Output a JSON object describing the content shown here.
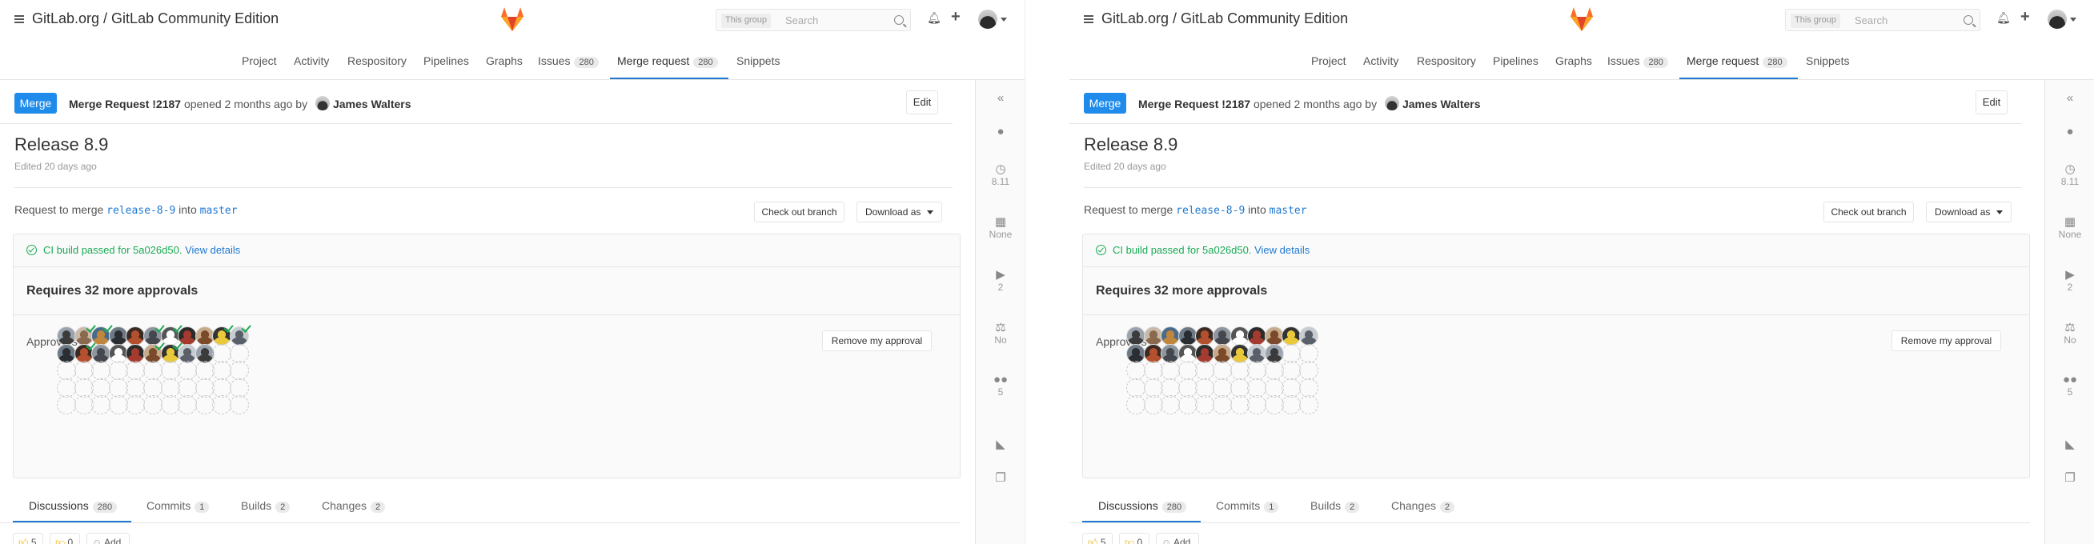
{
  "header": {
    "title": "GitLab.org / GitLab Community Edition",
    "search_scope": "This group",
    "search_placeholder": "Search"
  },
  "nav": [
    {
      "label": "Project"
    },
    {
      "label": "Activity"
    },
    {
      "label": "Respository"
    },
    {
      "label": "Pipelines"
    },
    {
      "label": "Graphs"
    },
    {
      "label": "Issues",
      "count": "280"
    },
    {
      "label": "Merge request",
      "count": "280",
      "active": true
    },
    {
      "label": "Snippets"
    }
  ],
  "mr": {
    "badge": "Merge",
    "title_strong": "Merge Request !2187",
    "opened": " opened 2 months ago by ",
    "author": "James Walters",
    "edit_label": "Edit",
    "release_title": "Release 8.9",
    "edited": "Edited 20 days ago",
    "request_prefix": "Request to merge ",
    "source_branch": "release-8-9",
    "into": " into ",
    "target_branch": "master",
    "checkout_label": "Check out branch",
    "download_label": "Download as"
  },
  "widget": {
    "ci_text": "CI build passed for 5a026d50.",
    "ci_link": "View details",
    "requires": "Requires 32 more approvals",
    "approvers_label": "Approvers",
    "remove_label": "Remove my approval"
  },
  "tabs": [
    {
      "label": "Discussions",
      "count": "280",
      "active": true
    },
    {
      "label": "Commits",
      "count": "1"
    },
    {
      "label": "Builds",
      "count": "2"
    },
    {
      "label": "Changes",
      "count": "2"
    }
  ],
  "awards": [
    {
      "icon": "thumbs-up-icon",
      "count": "5"
    },
    {
      "icon": "thumbs-down-icon",
      "count": "0"
    },
    {
      "icon": "smiley-icon",
      "label": "Add"
    }
  ],
  "sidebar": {
    "milestone": "8.11",
    "due_date": "None",
    "labels": "2",
    "lock": "No",
    "participants": "5"
  },
  "colors": {
    "accent": "#1f78d1",
    "merge_badge": "#1f8ceb",
    "success": "#1aaa55"
  },
  "screens": [
    {
      "approvers_row1": [
        1,
        1,
        1,
        1,
        1,
        1,
        1,
        1,
        1,
        1,
        1
      ],
      "approvers_row2": [
        1,
        1,
        1,
        1,
        1,
        1,
        1,
        1,
        1,
        0,
        0
      ],
      "approved_row1": [
        0,
        1,
        1,
        0,
        0,
        1,
        1,
        0,
        0,
        1,
        1
      ],
      "approved_row2": [
        0,
        1,
        0,
        0,
        0,
        1,
        1,
        0,
        0,
        0,
        0
      ]
    },
    {
      "approvers_row1": [
        1,
        1,
        1,
        1,
        1,
        1,
        1,
        1,
        1,
        1,
        1
      ],
      "approvers_row2": [
        1,
        1,
        1,
        1,
        1,
        1,
        1,
        1,
        1,
        0,
        0
      ],
      "approved_row1": [
        0,
        0,
        0,
        0,
        0,
        0,
        0,
        0,
        0,
        0,
        0
      ],
      "approved_row2": [
        0,
        0,
        0,
        0,
        0,
        0,
        0,
        0,
        0,
        0,
        0
      ]
    }
  ]
}
